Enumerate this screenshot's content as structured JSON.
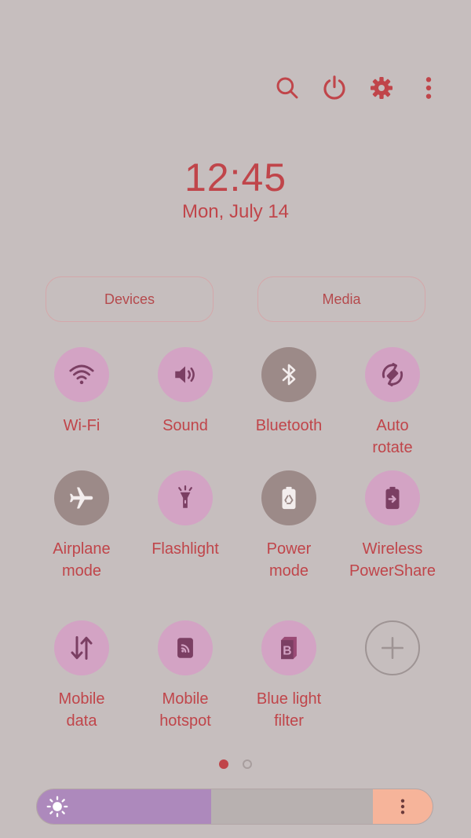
{
  "header": {
    "icons": [
      "search-icon",
      "power-icon",
      "gear-icon",
      "more-vert-icon"
    ]
  },
  "clock": {
    "time": "12:45",
    "date": "Mon, July 14"
  },
  "pills": {
    "devices": "Devices",
    "media": "Media"
  },
  "tiles": [
    {
      "label": "Wi-Fi",
      "state": "on",
      "icon": "wifi-icon"
    },
    {
      "label": "Sound",
      "state": "on",
      "icon": "speaker-icon"
    },
    {
      "label": "Bluetooth",
      "state": "off",
      "icon": "bluetooth-icon"
    },
    {
      "label": "Auto\nrotate",
      "state": "on",
      "icon": "auto-rotate-icon"
    },
    {
      "label": "Airplane\nmode",
      "state": "off",
      "icon": "airplane-icon"
    },
    {
      "label": "Flashlight",
      "state": "on",
      "icon": "flashlight-icon"
    },
    {
      "label": "Power\nmode",
      "state": "off",
      "icon": "battery-recycle-icon"
    },
    {
      "label": "Wireless\nPowerShare",
      "state": "on",
      "icon": "wireless-powershare-icon"
    },
    {
      "label": "Mobile\ndata",
      "state": "on",
      "icon": "data-arrows-icon"
    },
    {
      "label": "Mobile\nhotspot",
      "state": "on",
      "icon": "hotspot-icon"
    },
    {
      "label": "Blue light\nfilter",
      "state": "on",
      "icon": "blue-light-filter-icon"
    },
    {
      "label": "",
      "state": "add",
      "icon": "plus-icon"
    }
  ],
  "pagination": {
    "current": 1,
    "total": 2
  },
  "brightness": {
    "level": 0.44
  },
  "colors": {
    "accent": "#c0454a",
    "tile_on": "#d3a3c4",
    "tile_off": "#9c8a88",
    "icon_on": "#7b3f63",
    "icon_off": "#f3eded",
    "brightness_fill": "#ad89bc",
    "brightness_more": "#f6b49a"
  }
}
